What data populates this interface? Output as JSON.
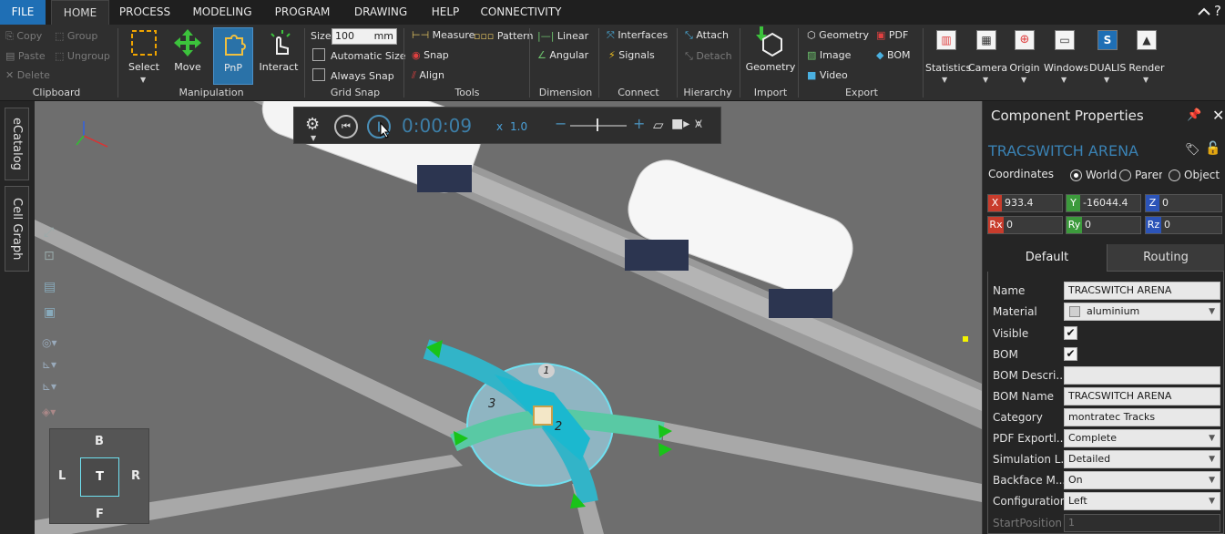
{
  "menu": {
    "file": "FILE",
    "tabs": [
      "HOME",
      "PROCESS",
      "MODELING",
      "PROGRAM",
      "DRAWING",
      "HELP",
      "CONNECTIVITY"
    ],
    "active_tab": "HOME"
  },
  "ribbon": {
    "clipboard": {
      "label": "Clipboard",
      "copy": "Copy",
      "paste": "Paste",
      "delete": "Delete",
      "group": "Group",
      "ungroup": "Ungroup"
    },
    "manipulation": {
      "label": "Manipulation",
      "select": "Select",
      "move": "Move",
      "pnp": "PnP",
      "interact": "Interact"
    },
    "grid_snap": {
      "label": "Grid Snap",
      "size_label": "Size",
      "size_value": "100",
      "size_unit": "mm",
      "automatic_size": "Automatic Size",
      "always_snap": "Always Snap"
    },
    "tools": {
      "label": "Tools",
      "measure": "Measure",
      "pattern": "Pattern",
      "snap": "Snap",
      "align": "Align"
    },
    "dimension": {
      "label": "Dimension",
      "linear": "Linear",
      "angular": "Angular"
    },
    "connect": {
      "label": "Connect",
      "interfaces": "Interfaces",
      "signals": "Signals"
    },
    "hierarchy": {
      "label": "Hierarchy",
      "attach": "Attach",
      "detach": "Detach"
    },
    "import": {
      "label": "Import",
      "geometry": "Geometry"
    },
    "export": {
      "label": "Export",
      "geometry": "Geometry",
      "pdf": "PDF",
      "image": "Image",
      "bom": "BOM",
      "video": "Video"
    },
    "statistics": "Statistics",
    "camera": "Camera",
    "origin": "Origin",
    "windows": "Windows",
    "dualis": "DUALIS",
    "render": "Render"
  },
  "left_dock": {
    "ecatalog": "eCatalog",
    "cell_graph": "Cell Graph"
  },
  "playback": {
    "time": "0:00:09",
    "speed_prefix": "x",
    "speed": "1.0"
  },
  "viewport": {
    "nav": {
      "top": "B",
      "left": "L",
      "center": "T",
      "right": "R",
      "bottom": "F"
    },
    "markers": [
      "1",
      "2",
      "3"
    ]
  },
  "panel": {
    "title": "Component Properties",
    "component_name": "TRACSWITCH ARENA",
    "coordinates_label": "Coordinates",
    "coord_options": [
      "World",
      "Parent",
      "Object"
    ],
    "coord_selected": "World",
    "x": "933.4",
    "y": "-16044.4",
    "z": "0",
    "rx": "0",
    "ry": "0",
    "rz": "0",
    "tabs": [
      "Default",
      "Routing"
    ],
    "properties": {
      "name_label": "Name",
      "name_value": "TRACSWITCH ARENA",
      "material_label": "Material",
      "material_value": "aluminium",
      "visible_label": "Visible",
      "bom_label": "BOM",
      "bom_desc_label": "BOM Descri...",
      "bom_desc_value": "",
      "bom_name_label": "BOM Name",
      "bom_name_value": "TRACSWITCH ARENA",
      "category_label": "Category",
      "category_value": "montratec Tracks",
      "pdf_export_label": "PDF Exportl...",
      "pdf_export_value": "Complete",
      "simulation_label": "Simulation L...",
      "simulation_value": "Detailed",
      "backface_label": "Backface M...",
      "backface_value": "On",
      "configuration_label": "Configuration",
      "configuration_value": "Left",
      "start_position_label": "StartPosition",
      "start_position_value": "1"
    }
  }
}
